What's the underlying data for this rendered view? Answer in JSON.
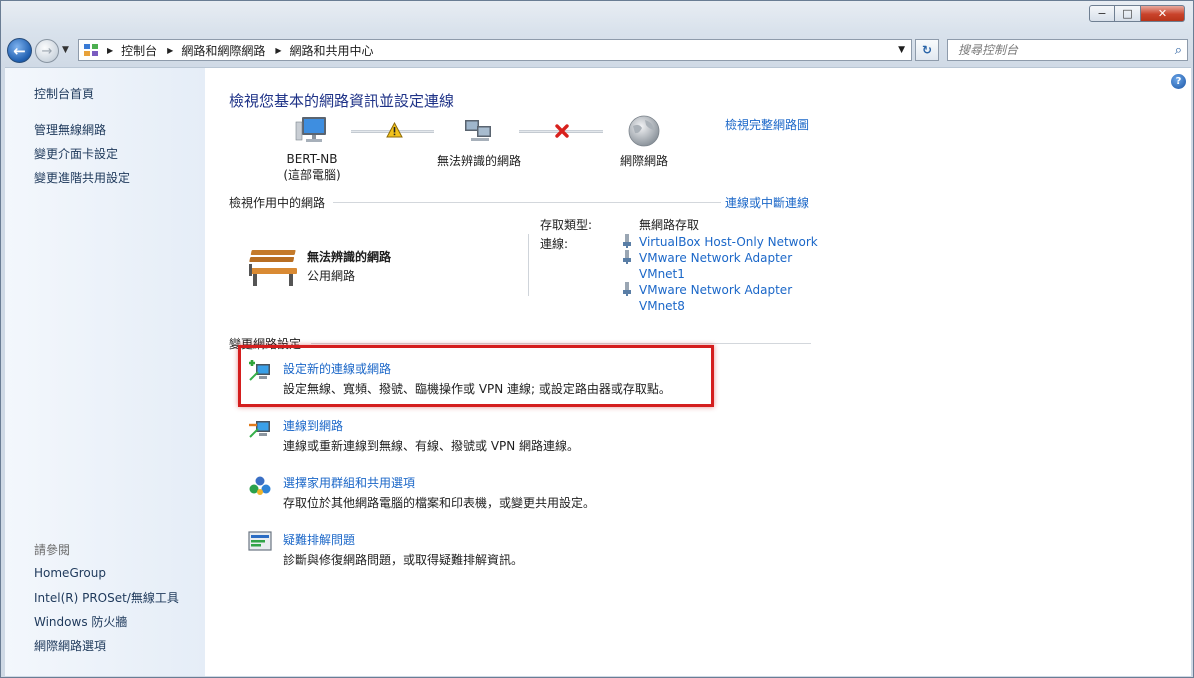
{
  "window": {
    "minimize_label": "−",
    "maximize_label": "□",
    "close_label": "✕"
  },
  "address_bar": {
    "crumbs": [
      "控制台",
      "網路和網際網路",
      "網路和共用中心"
    ],
    "search_placeholder": "搜尋控制台"
  },
  "sidebar": {
    "home": "控制台首頁",
    "links": [
      "管理無線網路",
      "變更介面卡設定",
      "變更進階共用設定"
    ],
    "see_also_heading": "請參閱",
    "see_also": [
      "HomeGroup",
      "Intel(R) PROSet/無線工具",
      "Windows 防火牆",
      "網際網路選項"
    ]
  },
  "main": {
    "title": "檢視您基本的網路資訊並設定連線",
    "full_map_link": "檢視完整網路圖",
    "map": {
      "computer_name": "BERT-NB",
      "computer_sub": "(這部電腦)",
      "network_name": "無法辨識的網路",
      "internet": "網際網路"
    },
    "active_section": {
      "heading": "檢視作用中的網路",
      "link": "連線或中斷連線",
      "network_name": "無法辨識的網路",
      "network_type": "公用網路",
      "access_type_label": "存取類型:",
      "access_type_value": "無網路存取",
      "connections_label": "連線:",
      "connections": [
        {
          "line1": "VirtualBox Host-Only Network",
          "line2": ""
        },
        {
          "line1": "VMware Network Adapter",
          "line2": "VMnet1"
        },
        {
          "line1": "VMware Network Adapter",
          "line2": "VMnet8"
        }
      ]
    },
    "change_section": {
      "heading": "變更網路設定",
      "tasks": [
        {
          "title": "設定新的連線或網路",
          "desc": "設定無線、寬頻、撥號、臨機操作或 VPN 連線; 或設定路由器或存取點。"
        },
        {
          "title": "連線到網路",
          "desc": "連線或重新連線到無線、有線、撥號或 VPN 網路連線。"
        },
        {
          "title": "選擇家用群組和共用選項",
          "desc": "存取位於其他網路電腦的檔案和印表機，或變更共用設定。"
        },
        {
          "title": "疑難排解問題",
          "desc": "診斷與修復網路問題，或取得疑難排解資訊。"
        }
      ]
    }
  },
  "colors": {
    "link": "#1b67c8",
    "title": "#1e3287",
    "highlight": "#d41e1e",
    "warning": "#f2c21b",
    "error": "#d8211d"
  }
}
